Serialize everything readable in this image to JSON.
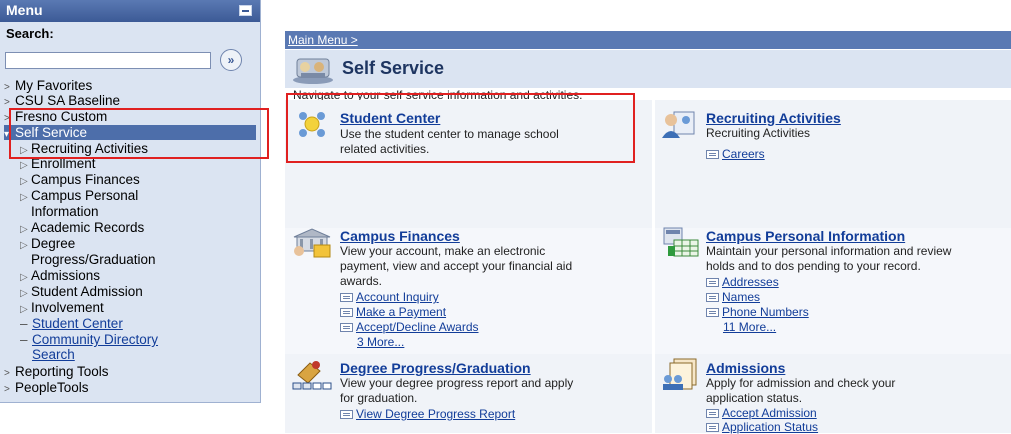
{
  "menu": {
    "title": "Menu",
    "search_label": "Search:",
    "search_value": "",
    "go_symbol": "»",
    "items": [
      {
        "label": "My Favorites"
      },
      {
        "label": "CSU SA Baseline"
      },
      {
        "label": "Fresno Custom"
      },
      {
        "label": "Self Service"
      }
    ],
    "sub_items": [
      {
        "label": "Recruiting Activities"
      },
      {
        "label": "Enrollment"
      },
      {
        "label": "Campus Finances"
      },
      {
        "label": "Campus Personal"
      },
      {
        "label": "Information"
      },
      {
        "label": "Academic Records"
      },
      {
        "label": "Degree"
      },
      {
        "label": "Progress/Graduation"
      },
      {
        "label": "Admissions"
      },
      {
        "label": "Student Admission"
      },
      {
        "label": "Involvement"
      }
    ],
    "links": [
      {
        "label": "Student Center"
      },
      {
        "label": "Community Directory"
      },
      {
        "label": "Search"
      }
    ],
    "bottom_items": [
      {
        "label": "Reporting Tools"
      },
      {
        "label": "PeopleTools"
      }
    ]
  },
  "content": {
    "breadcrumb": "Main Menu >",
    "page_title": "Self Service",
    "intro": "Navigate to your self service information and activities.",
    "tiles": {
      "student_center": {
        "title": "Student Center",
        "desc1": "Use the student center to manage school",
        "desc2": "related activities."
      },
      "recruiting": {
        "title": "Recruiting Activities",
        "desc1": "Recruiting Activities",
        "links": [
          "Careers"
        ]
      },
      "finances": {
        "title": "Campus Finances",
        "desc1": "View your account, make an electronic",
        "desc2": "payment, view and accept your financial aid",
        "desc3": "awards.",
        "links": [
          "Account Inquiry",
          "Make a Payment",
          "Accept/Decline Awards"
        ],
        "more": "3 More..."
      },
      "personal": {
        "title": "Campus Personal Information",
        "desc1": "Maintain your personal information and review",
        "desc2": "holds and to dos pending to your record.",
        "links": [
          "Addresses",
          "Names",
          "Phone Numbers"
        ],
        "more": "11 More..."
      },
      "degree": {
        "title": "Degree Progress/Graduation",
        "desc1": "View your degree progress report and apply",
        "desc2": "for graduation.",
        "links": [
          "View Degree Progress Report"
        ]
      },
      "admissions": {
        "title": "Admissions",
        "desc1": "Apply for admission and check your",
        "desc2": "application status.",
        "links": [
          "Accept Admission",
          "Application Status"
        ]
      }
    }
  },
  "colors": {
    "header_blue": "#3c5a96",
    "panel_bg": "#dbe4f2",
    "link": "#123d99",
    "highlight": "#e02020"
  }
}
